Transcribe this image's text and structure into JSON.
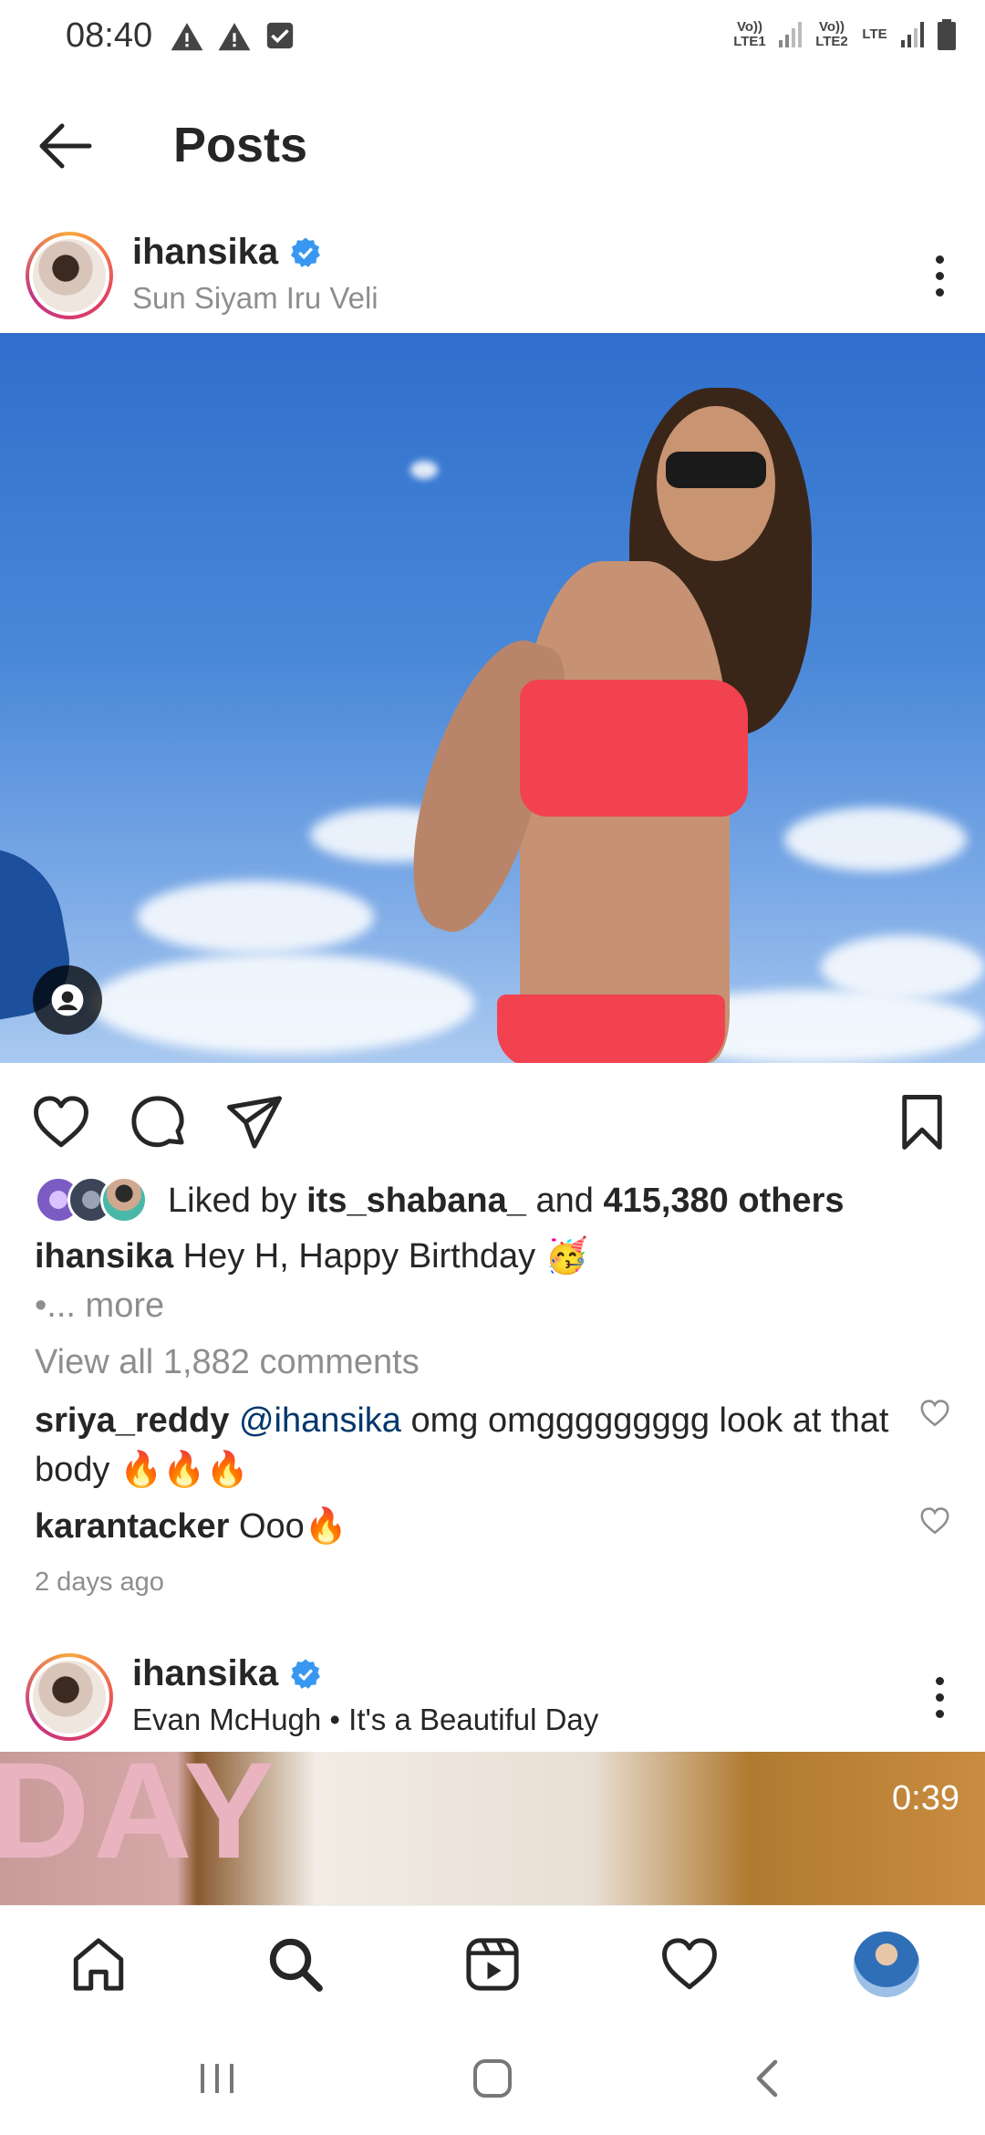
{
  "status": {
    "time": "08:40",
    "sim1": "Vo)) LTE1",
    "sim2": "Vo)) LTE2",
    "lte": "LTE"
  },
  "header": {
    "title": "Posts"
  },
  "post1": {
    "username": "ihansika",
    "location": "Sun Siyam Iru Veli",
    "likes_prefix": "Liked by",
    "liked_by_user": "its_shabana_",
    "likes_and": "and",
    "likes_count": "415,380 others",
    "caption_user": "ihansika",
    "caption_text": "Hey H, Happy Birthday 🥳",
    "more_text": "•... more",
    "view_comments": "View all 1,882 comments",
    "comments": [
      {
        "user": "sriya_reddy",
        "mention": "@ihansika",
        "text": "omg omggggggggg look at that body 🔥🔥🔥"
      },
      {
        "user": "karantacker",
        "mention": "",
        "text": "Ooo🔥"
      }
    ],
    "time_ago": "2 days ago"
  },
  "post2": {
    "username": "ihansika",
    "location": "Evan McHugh • It's a Beautiful Day",
    "video_duration": "0:39",
    "video_text": "DAY"
  },
  "colors": {
    "verified": "#3897f0",
    "mention": "#00376b",
    "muted": "#8e8e8e"
  }
}
